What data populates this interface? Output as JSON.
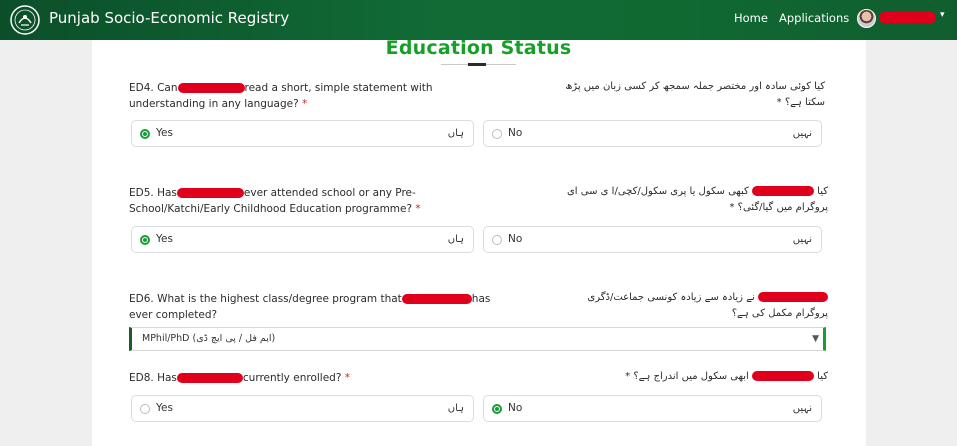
{
  "header": {
    "app_title": "Punjab Socio-Economic Registry",
    "nav": {
      "home": "Home",
      "applications": "Applications"
    },
    "user_caret": "▾"
  },
  "page_title": "Education Status",
  "questions": {
    "ed4": {
      "en_prefix": "ED4. Can",
      "en_line1_tail": "read a short, simple statement with",
      "en_line2": "understanding in any language?",
      "required_mark": "*",
      "ur": "کیا کوئی سادہ اور مختصر جملہ سمجھ کر کسی زبان میں پڑھ سکتا ہے؟ *",
      "options": [
        {
          "en": "Yes",
          "ur": "ہاں",
          "selected": true
        },
        {
          "en": "No",
          "ur": "نہیں",
          "selected": false
        }
      ]
    },
    "ed5": {
      "en_prefix": "ED5. Has",
      "en_line1_tail": "ever attended school or any Pre-",
      "en_line2": "School/Katchi/Early Childhood Education programme?",
      "required_mark": "*",
      "ur_prefix": "کیا",
      "ur_tail": "کبھی سکول یا پری سکول/کچی/ا ی سی ای پروگرام میں گیا/گئی؟ *",
      "options": [
        {
          "en": "Yes",
          "ur": "ہاں",
          "selected": true
        },
        {
          "en": "No",
          "ur": "نہیں",
          "selected": false
        }
      ]
    },
    "ed6": {
      "en_prefix": "ED6. What is the highest class/degree program that",
      "en_line1_tail": "has",
      "en_line2": "ever completed?",
      "ur_tail": "نے زیادہ سے زیادہ کونسی جماعت/ڈگری پروگرام مکمل کی ہے؟",
      "selected_value": "MPhil/PhD (ایم فل / پی ایچ ڈی)",
      "caret": "▼"
    },
    "ed8": {
      "en_prefix": "ED8. Has",
      "en_line1_tail": "currently enrolled?",
      "required_mark": "*",
      "ur_prefix": "کیا",
      "ur_tail": "ابھی سکول میں اندراج ہے؟ *",
      "options": [
        {
          "en": "Yes",
          "ur": "ہاں",
          "selected": false
        },
        {
          "en": "No",
          "ur": "نہیں",
          "selected": true
        }
      ]
    }
  },
  "colors": {
    "header_green": "#116b35",
    "title_green": "#16a028",
    "radio_green": "#1a9c35",
    "redaction_red": "#e0001b"
  },
  "icons": {
    "logo": "punjab-government-logo-icon",
    "avatar": "user-avatar",
    "radio": "radio-button-icon"
  }
}
